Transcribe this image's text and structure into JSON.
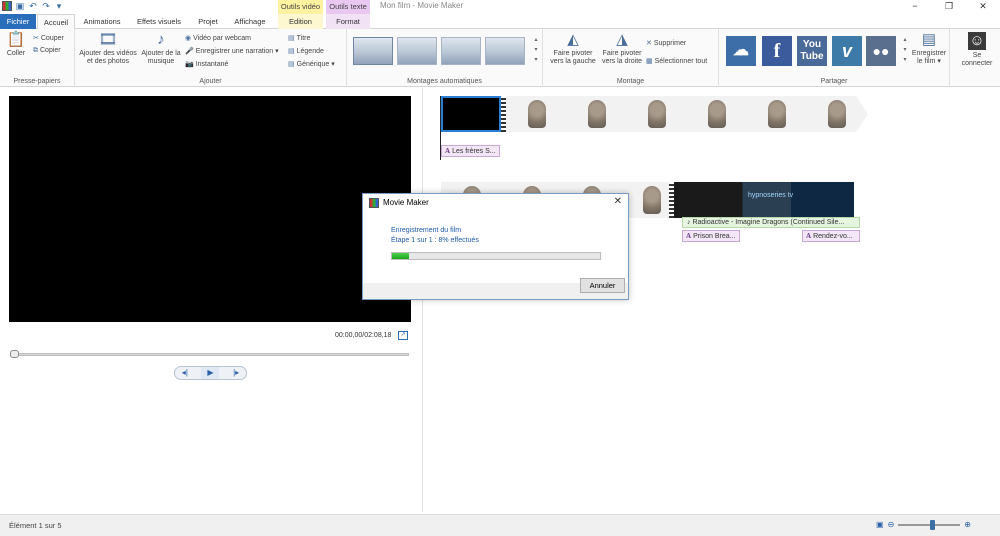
{
  "window": {
    "title": "Mon film - Movie Maker",
    "controls": {
      "minimize": "−",
      "restore": "❐",
      "close": "✕"
    }
  },
  "context_tabs": {
    "video_tools": "Outils vidéo",
    "text_tools": "Outils texte"
  },
  "tabs": {
    "file": "Fichier",
    "home": "Accueil",
    "animations": "Animations",
    "visual_effects": "Effets visuels",
    "project": "Projet",
    "view": "Affichage",
    "edit": "Edition",
    "format": "Format"
  },
  "ribbon": {
    "clipboard": {
      "label": "Presse-papiers",
      "paste": "Coller",
      "cut": "Couper",
      "copy": "Copier"
    },
    "add": {
      "label": "Ajouter",
      "add_videos_1": "Ajouter des vidéos",
      "add_videos_2": "et des photos",
      "add_music_1": "Ajouter de la",
      "add_music_2": "musique",
      "webcam": "Vidéo par webcam",
      "narration": "Enregistrer une narration",
      "snapshot": "Instantané",
      "title": "Titre",
      "caption": "Légende",
      "credits": "Générique"
    },
    "automovie": {
      "label": "Montages automatiques"
    },
    "editing": {
      "label": "Montage",
      "rotate_left_1": "Faire pivoter",
      "rotate_left_2": "vers la gauche",
      "rotate_right_1": "Faire pivoter",
      "rotate_right_2": "vers la droite",
      "delete": "Supprimer",
      "select_all": "Sélectionner tout"
    },
    "share": {
      "label": "Partager",
      "save_movie_1": "Enregistrer",
      "save_movie_2": "le film",
      "social_icons": [
        "onedrive-icon",
        "facebook-icon",
        "youtube-icon",
        "vimeo-icon",
        "flickr-icon"
      ],
      "facebook_glyph": "f",
      "youtube_glyph_1": "You",
      "youtube_glyph_2": "Tube",
      "vimeo_glyph": "v"
    },
    "signin": {
      "label_1": "Se",
      "label_2": "connecter"
    }
  },
  "preview": {
    "timecode": "00:00,00/02:08,18",
    "position_fraction": 0.0
  },
  "storyboard": {
    "captions": {
      "first": "Les frères S...",
      "prison": "Prison Brea...",
      "rendezvous": "Rendez-vo..."
    },
    "caption_icon": "A",
    "music_icon": "♪",
    "music": "Radioactive - Imagine Dragons (Continued Sile...",
    "promo_text": "hypnoseries tv"
  },
  "dialog": {
    "title": "Movie Maker",
    "line1": "Enregistrement du film",
    "line2": "Étape 1 sur 1 : 8% effectués",
    "progress": 0.08,
    "cancel": "Annuler",
    "close": "✕"
  },
  "status": {
    "text": "Élément 1 sur 5",
    "zoom_fraction": 0.55
  },
  "colors": {
    "accent": "#2a6ebb",
    "progress": "#1aa61a",
    "video_tools": "#fdf2a0",
    "text_tools": "#e8c8f0"
  }
}
